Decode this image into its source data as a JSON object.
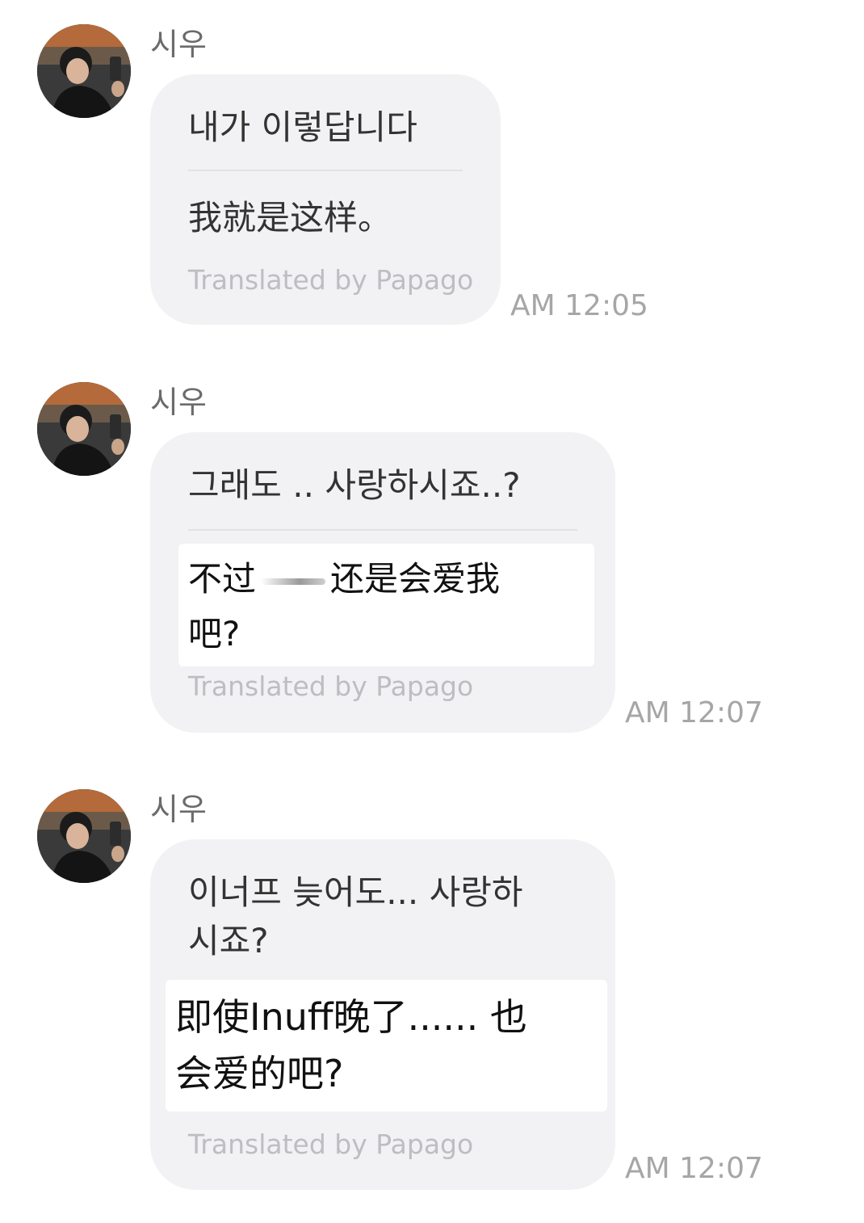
{
  "messages": [
    {
      "sender": "시우",
      "original": "내가 이렇답니다",
      "translation": "我就是这样。",
      "credit": "Translated by Papago",
      "time": "AM 12:05"
    },
    {
      "sender": "시우",
      "original": "그래도 .. 사랑하시죠..?",
      "translation_part1": "不过",
      "translation_part2": "还是会爱我",
      "translation_line2": "吧?",
      "credit": "Translated by Papago",
      "time": "AM 12:07"
    },
    {
      "sender": "시우",
      "original_line1": "이너프 늦어도... 사랑하",
      "original_line2": "시죠?",
      "translation_line1": "即使Inuff晚了...... 也",
      "translation_line2": "会爱的吧?",
      "credit": "Translated by Papago",
      "time": "AM 12:07"
    }
  ],
  "icons": {
    "avatar": "profile-photo-icon"
  }
}
